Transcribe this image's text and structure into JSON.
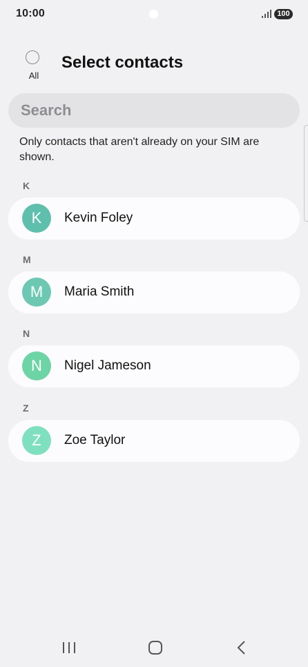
{
  "status_bar": {
    "time": "10:00",
    "battery": "100",
    "signal_icon": "signal-icon"
  },
  "header": {
    "select_all_label": "All",
    "title": "Select contacts"
  },
  "search": {
    "placeholder": "Search",
    "value": ""
  },
  "info_text": "Only contacts that aren't already on your SIM are shown.",
  "sections": [
    {
      "letter": "K",
      "contacts": [
        {
          "name": "Kevin Foley",
          "initial": "K",
          "avatar_color": "#5fbfad"
        }
      ]
    },
    {
      "letter": "M",
      "contacts": [
        {
          "name": "Maria Smith",
          "initial": "M",
          "avatar_color": "#6cc8b3"
        }
      ]
    },
    {
      "letter": "N",
      "contacts": [
        {
          "name": "Nigel Jameson",
          "initial": "N",
          "avatar_color": "#6dd4a5"
        }
      ]
    },
    {
      "letter": "Z",
      "contacts": [
        {
          "name": "Zoe Taylor",
          "initial": "Z",
          "avatar_color": "#7fe0bf"
        }
      ]
    }
  ],
  "nav_bar": {
    "recents_icon": "recents-icon",
    "home_icon": "home-icon",
    "back_icon": "back-icon"
  }
}
